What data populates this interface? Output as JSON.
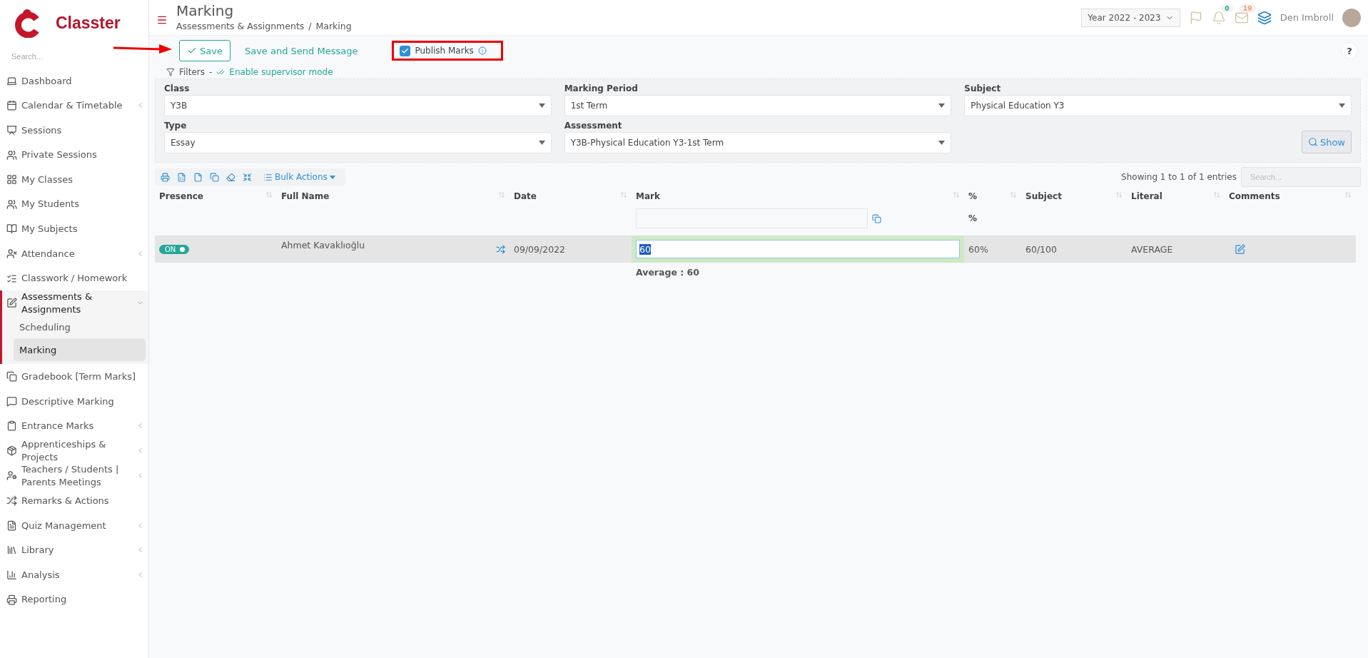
{
  "sidebar": {
    "brand": "Classter",
    "search_placeholder": "Search...",
    "items": [
      {
        "label": "Dashboard",
        "submenu": false,
        "expanded": false
      },
      {
        "label": "Calendar & Timetable",
        "submenu": true,
        "expanded": false
      },
      {
        "label": "Sessions",
        "submenu": false,
        "expanded": false
      },
      {
        "label": "Private Sessions",
        "submenu": false,
        "expanded": false
      },
      {
        "label": "My Classes",
        "submenu": false,
        "expanded": false
      },
      {
        "label": "My Students",
        "submenu": false,
        "expanded": false
      },
      {
        "label": "My Subjects",
        "submenu": false,
        "expanded": false
      },
      {
        "label": "Attendance",
        "submenu": true,
        "expanded": false
      },
      {
        "label": "Classwork / Homework",
        "submenu": false,
        "expanded": false
      },
      {
        "label": "Assessments & Assignments",
        "submenu": true,
        "expanded": true,
        "children": [
          {
            "label": "Scheduling",
            "selected": false
          },
          {
            "label": "Marking",
            "selected": true
          }
        ]
      },
      {
        "label": "Gradebook [Term Marks]",
        "submenu": false,
        "expanded": false
      },
      {
        "label": "Descriptive Marking",
        "submenu": false,
        "expanded": false
      },
      {
        "label": "Entrance Marks",
        "submenu": true,
        "expanded": false
      },
      {
        "label": "Apprenticeships & Projects",
        "submenu": true,
        "expanded": false
      },
      {
        "label": "Teachers / Students | Parents Meetings",
        "submenu": true,
        "expanded": false
      },
      {
        "label": "Remarks & Actions",
        "submenu": false,
        "expanded": false
      },
      {
        "label": "Quiz Management",
        "submenu": true,
        "expanded": false
      },
      {
        "label": "Library",
        "submenu": true,
        "expanded": false
      },
      {
        "label": "Analysis",
        "submenu": true,
        "expanded": false
      },
      {
        "label": "Reporting",
        "submenu": false,
        "expanded": false
      }
    ]
  },
  "header": {
    "title": "Marking",
    "breadcrumb": [
      "Assessments & Assignments",
      "Marking"
    ],
    "breadcrumb_separator": "/",
    "year": "Year 2022 - 2023",
    "notifications": "0",
    "messages": "19",
    "user": "Den Imbroll"
  },
  "actions": {
    "save": "Save",
    "save_send": "Save and Send Message",
    "publish": {
      "label": "Publish Marks",
      "checked": true,
      "highlighted": true
    },
    "pointer_arrow": true,
    "help": "?"
  },
  "filters": {
    "label": "Filters",
    "separator": "-",
    "supervisor": "Enable supervisor mode",
    "fields": [
      {
        "label": "Class",
        "value": "Y3B"
      },
      {
        "label": "Marking Period",
        "value": "1st Term"
      },
      {
        "label": "Subject",
        "value": "Physical Education Y3"
      },
      {
        "label": "Type",
        "value": "Essay"
      },
      {
        "label": "Assessment",
        "value": "Y3B-Physical Education Y3-1st Term"
      }
    ],
    "show": "Show"
  },
  "table": {
    "bulk": "Bulk Actions",
    "info": "Showing 1 to 1 of 1 entries",
    "search_placeholder": "Search...",
    "columns": [
      "Presence",
      "Full Name",
      "Date",
      "Mark",
      "%",
      "Subject",
      "Literal",
      "Comments"
    ],
    "percent_sub": "%",
    "rows": [
      {
        "presence": {
          "label": "ON",
          "on": true
        },
        "name": "Ahmet Kavaklıoğlu",
        "date": "09/09/2022",
        "mark": "60",
        "percent": "60%",
        "subject": "60/100",
        "literal": "AVERAGE"
      }
    ],
    "average": "Average : 60"
  }
}
